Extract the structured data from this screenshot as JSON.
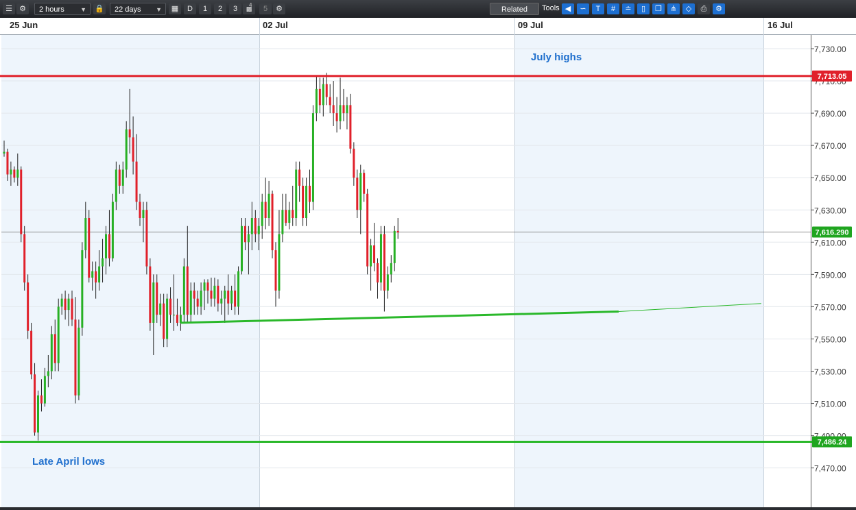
{
  "toolbar": {
    "interval": "2 hours",
    "range": "22 days",
    "period_buttons": [
      "D",
      "1",
      "2",
      "3"
    ],
    "disabled_button": "5",
    "superscript": "4",
    "related_label": "Related",
    "tools_label": "Tools",
    "tool_icons": [
      "arrow-left-icon",
      "curve-icon",
      "text-icon",
      "grid-icon",
      "fib-icon",
      "candle-icon",
      "layers-icon",
      "fork-icon",
      "shape-icon",
      "print-icon",
      "settings-icon"
    ]
  },
  "colors": {
    "up": "#27b024",
    "down": "#e0202a",
    "resistance": "#e0202a",
    "support": "#2ab82a",
    "band": "#eef5fc",
    "annotation": "#1f6fcd"
  },
  "chart_data": {
    "type": "candlestick",
    "x_labels": [
      "25 Jun",
      "02 Jul",
      "09 Jul",
      "16 Jul"
    ],
    "y_ticks": [
      7730,
      7710,
      7690,
      7670,
      7650,
      7630,
      7610,
      7590,
      7570,
      7550,
      7530,
      7510,
      7490,
      7470
    ],
    "y_tick_labels": [
      "7,730.00",
      "7,710.00",
      "7,690.00",
      "7,670.00",
      "7,650.00",
      "7,630.00",
      "7,610.00",
      "7,590.00",
      "7,570.00",
      "7,550.00",
      "7,530.00",
      "7,510.00",
      "7,490.00",
      "7,470.00"
    ],
    "ylim": [
      7460,
      7740
    ],
    "resistance": {
      "value": 7713.05,
      "label": "7,713.05"
    },
    "support": {
      "value": 7486.24,
      "label": "7,486.24"
    },
    "current_price": {
      "value": 7616.29,
      "label": "7,616.290"
    },
    "trendline": {
      "from": [
        52,
        7560
      ],
      "to": [
        181,
        7567
      ],
      "extend_to": [
        223,
        7572
      ]
    },
    "annotations": {
      "top": "July highs",
      "bottom": "Late April lows"
    },
    "candles": [
      [
        7665,
        7673,
        7663,
        7666
      ],
      [
        7666,
        7668,
        7648,
        7652
      ],
      [
        7652,
        7660,
        7645,
        7655
      ],
      [
        7655,
        7657,
        7647,
        7650
      ],
      [
        7650,
        7665,
        7645,
        7655
      ],
      [
        7655,
        7657,
        7610,
        7615
      ],
      [
        7615,
        7620,
        7580,
        7585
      ],
      [
        7585,
        7590,
        7550,
        7555
      ],
      [
        7555,
        7560,
        7525,
        7528
      ],
      [
        7528,
        7535,
        7490,
        7492
      ],
      [
        7492,
        7518,
        7487,
        7515
      ],
      [
        7515,
        7525,
        7505,
        7510
      ],
      [
        7510,
        7532,
        7508,
        7527
      ],
      [
        7527,
        7540,
        7520,
        7530
      ],
      [
        7530,
        7558,
        7525,
        7553
      ],
      [
        7553,
        7562,
        7530,
        7535
      ],
      [
        7535,
        7575,
        7530,
        7570
      ],
      [
        7570,
        7578,
        7565,
        7575
      ],
      [
        7575,
        7580,
        7562,
        7568
      ],
      [
        7568,
        7578,
        7558,
        7575
      ],
      [
        7575,
        7580,
        7558,
        7562
      ],
      [
        7562,
        7576,
        7510,
        7515
      ],
      [
        7515,
        7562,
        7512,
        7557
      ],
      [
        7557,
        7610,
        7552,
        7605
      ],
      [
        7605,
        7635,
        7600,
        7625
      ],
      [
        7625,
        7630,
        7585,
        7588
      ],
      [
        7588,
        7598,
        7580,
        7592
      ],
      [
        7592,
        7598,
        7575,
        7585
      ],
      [
        7585,
        7605,
        7580,
        7595
      ],
      [
        7595,
        7612,
        7585,
        7600
      ],
      [
        7600,
        7620,
        7590,
        7615
      ],
      [
        7615,
        7630,
        7595,
        7600
      ],
      [
        7600,
        7640,
        7598,
        7635
      ],
      [
        7635,
        7660,
        7630,
        7655
      ],
      [
        7655,
        7658,
        7640,
        7645
      ],
      [
        7645,
        7660,
        7640,
        7655
      ],
      [
        7655,
        7685,
        7650,
        7680
      ],
      [
        7680,
        7705,
        7665,
        7675
      ],
      [
        7675,
        7688,
        7652,
        7660
      ],
      [
        7660,
        7677,
        7630,
        7635
      ],
      [
        7635,
        7640,
        7620,
        7625
      ],
      [
        7625,
        7635,
        7610,
        7630
      ],
      [
        7630,
        7635,
        7590,
        7595
      ],
      [
        7595,
        7600,
        7555,
        7560
      ],
      [
        7560,
        7590,
        7540,
        7585
      ],
      [
        7585,
        7590,
        7560,
        7565
      ],
      [
        7565,
        7578,
        7558,
        7572
      ],
      [
        7572,
        7578,
        7545,
        7550
      ],
      [
        7550,
        7578,
        7545,
        7575
      ],
      [
        7575,
        7582,
        7560,
        7565
      ],
      [
        7565,
        7590,
        7555,
        7565
      ],
      [
        7565,
        7575,
        7558,
        7560
      ],
      [
        7560,
        7570,
        7555,
        7565
      ],
      [
        7565,
        7600,
        7560,
        7595
      ],
      [
        7595,
        7620,
        7560,
        7565
      ],
      [
        7565,
        7585,
        7560,
        7580
      ],
      [
        7580,
        7585,
        7565,
        7575
      ],
      [
        7575,
        7580,
        7565,
        7570
      ],
      [
        7570,
        7585,
        7565,
        7580
      ],
      [
        7580,
        7587,
        7568,
        7585
      ],
      [
        7585,
        7587,
        7572,
        7580
      ],
      [
        7580,
        7588,
        7570,
        7575
      ],
      [
        7575,
        7588,
        7570,
        7583
      ],
      [
        7583,
        7587,
        7567,
        7572
      ],
      [
        7572,
        7580,
        7565,
        7575
      ],
      [
        7575,
        7583,
        7560,
        7580
      ],
      [
        7580,
        7590,
        7565,
        7572
      ],
      [
        7572,
        7583,
        7568,
        7580
      ],
      [
        7580,
        7590,
        7565,
        7570
      ],
      [
        7570,
        7595,
        7565,
        7592
      ],
      [
        7592,
        7625,
        7590,
        7620
      ],
      [
        7620,
        7625,
        7605,
        7610
      ],
      [
        7610,
        7620,
        7590,
        7615
      ],
      [
        7615,
        7635,
        7605,
        7625
      ],
      [
        7625,
        7630,
        7610,
        7615
      ],
      [
        7615,
        7625,
        7605,
        7620
      ],
      [
        7620,
        7640,
        7612,
        7635
      ],
      [
        7635,
        7650,
        7618,
        7625
      ],
      [
        7625,
        7648,
        7620,
        7640
      ],
      [
        7640,
        7642,
        7600,
        7605
      ],
      [
        7605,
        7610,
        7570,
        7580
      ],
      [
        7580,
        7630,
        7575,
        7615
      ],
      [
        7615,
        7640,
        7610,
        7630
      ],
      [
        7630,
        7640,
        7620,
        7622
      ],
      [
        7622,
        7635,
        7618,
        7630
      ],
      [
        7630,
        7645,
        7620,
        7625
      ],
      [
        7625,
        7660,
        7620,
        7655
      ],
      [
        7655,
        7660,
        7635,
        7645
      ],
      [
        7645,
        7650,
        7620,
        7625
      ],
      [
        7625,
        7650,
        7620,
        7645
      ],
      [
        7645,
        7655,
        7628,
        7635
      ],
      [
        7635,
        7695,
        7630,
        7690
      ],
      [
        7690,
        7713,
        7685,
        7705
      ],
      [
        7705,
        7712,
        7690,
        7695
      ],
      [
        7695,
        7712,
        7688,
        7708
      ],
      [
        7708,
        7715,
        7695,
        7700
      ],
      [
        7700,
        7708,
        7690,
        7695
      ],
      [
        7695,
        7710,
        7682,
        7690
      ],
      [
        7690,
        7700,
        7678,
        7685
      ],
      [
        7685,
        7712,
        7680,
        7695
      ],
      [
        7695,
        7705,
        7685,
        7690
      ],
      [
        7690,
        7700,
        7680,
        7695
      ],
      [
        7695,
        7702,
        7665,
        7668
      ],
      [
        7668,
        7672,
        7645,
        7650
      ],
      [
        7650,
        7655,
        7625,
        7630
      ],
      [
        7630,
        7658,
        7615,
        7653
      ],
      [
        7653,
        7655,
        7635,
        7640
      ],
      [
        7640,
        7643,
        7590,
        7595
      ],
      [
        7595,
        7612,
        7580,
        7608
      ],
      [
        7608,
        7622,
        7592,
        7597
      ],
      [
        7597,
        7600,
        7575,
        7585
      ],
      [
        7585,
        7620,
        7580,
        7615
      ],
      [
        7615,
        7620,
        7567,
        7580
      ],
      [
        7580,
        7595,
        7575,
        7590
      ],
      [
        7590,
        7602,
        7585,
        7597
      ],
      [
        7597,
        7620,
        7592,
        7617
      ],
      [
        7617,
        7625,
        7612,
        7616
      ]
    ]
  }
}
